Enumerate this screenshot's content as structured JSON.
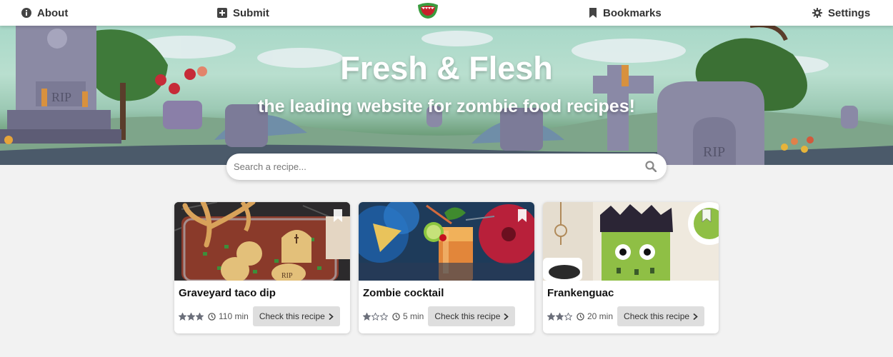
{
  "nav": {
    "about": "About",
    "submit": "Submit",
    "bookmarks": "Bookmarks",
    "settings": "Settings",
    "icons": {
      "about": "info-circle-icon",
      "submit": "plus-square-icon",
      "bookmarks": "bookmark-icon",
      "settings": "gear-icon",
      "logo": "zombie-mouth-logo"
    }
  },
  "hero": {
    "title": "Fresh & Flesh",
    "subtitle": "the leading website for zombie food recipes!",
    "tombstone_text": "RIP"
  },
  "search": {
    "placeholder": "Search a recipe...",
    "value": "",
    "icon": "search-icon"
  },
  "recipes": [
    {
      "title": "Graveyard taco dip",
      "rating": 3,
      "max_rating": 3,
      "time": "110 min",
      "button": "Check this recipe",
      "image": "taco-dip-photo",
      "image_text": "RIP"
    },
    {
      "title": "Zombie cocktail",
      "rating": 1,
      "max_rating": 3,
      "time": "5 min",
      "button": "Check this recipe",
      "image": "cocktail-photo"
    },
    {
      "title": "Frankenguac",
      "rating": 2,
      "max_rating": 3,
      "time": "20 min",
      "button": "Check this recipe",
      "image": "frankenguac-photo"
    }
  ],
  "colors": {
    "nav_bg": "#ffffff",
    "page_bg": "#f2f2f2",
    "button_bg": "#dedede",
    "star": "#6b6f7a",
    "text": "#222222"
  }
}
